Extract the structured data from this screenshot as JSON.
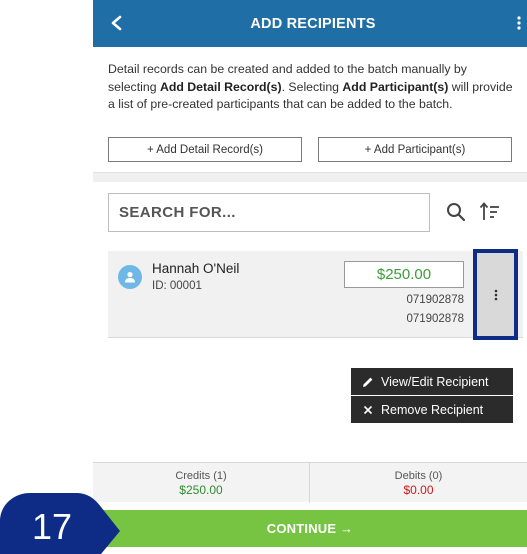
{
  "header": {
    "back_icon": "chevron-left-icon",
    "title": "ADD RECIPIENTS",
    "more_icon": "vertical-ellipsis-icon"
  },
  "description": {
    "part1": "Detail records can be created and added to the batch manually by selecting ",
    "bold1": "Add Detail Record(s)",
    "part2": ". Selecting ",
    "bold2": "Add Participant(s)",
    "part3": " will provide a list of pre-created participants that can be added to the batch."
  },
  "actions": {
    "add_detail_record": "+ Add Detail Record(s)",
    "add_participant": "+ Add Participant(s)"
  },
  "search": {
    "placeholder": "SEARCH FOR...",
    "search_icon": "search-icon",
    "sort_icon": "sort-icon"
  },
  "recipient": {
    "name": "Hannah O'Neil",
    "id": "ID: 00001",
    "amount": "$250.00",
    "routing_line1": "071902878",
    "routing_line2": "071902878"
  },
  "context_menu": {
    "items": [
      {
        "label": "View/Edit Recipient",
        "icon": "pencil-icon"
      },
      {
        "label": "Remove Recipient",
        "icon": "close-icon"
      }
    ]
  },
  "totals": {
    "credits_label": "Credits (1)",
    "credits_value": "$250.00",
    "debits_label": "Debits (0)",
    "debits_value": "$0.00"
  },
  "continue_label": "CONTINUE →",
  "step_badge": "17",
  "colors": {
    "header_bg": "#1f6ea6",
    "continue_bg": "#76c442",
    "credit_green": "#2e8b2e",
    "debit_red": "#cc1b1b",
    "amount_green": "#3a9c3a",
    "highlight_border": "#0e2b86",
    "badge_bg": "#0e2b86"
  }
}
